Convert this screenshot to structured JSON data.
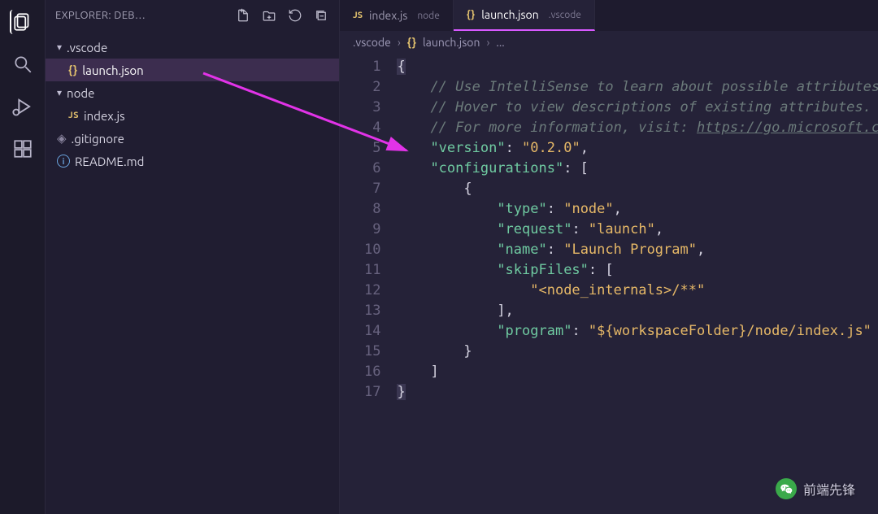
{
  "sidebar": {
    "title": "EXPLORER: DEB…",
    "actions": {
      "new_file": "new-file",
      "new_folder": "new-folder",
      "refresh": "refresh",
      "collapse": "collapse-all"
    },
    "tree": {
      "vscode_folder": ".vscode",
      "launch_json": "launch.json",
      "node_folder": "node",
      "index_js": "index.js",
      "gitignore": ".gitignore",
      "readme": "README.md"
    }
  },
  "tabs": {
    "index": {
      "name": "index.js",
      "desc": "node"
    },
    "launch": {
      "name": "launch.json",
      "desc": ".vscode"
    }
  },
  "breadcrumb": {
    "seg1": ".vscode",
    "seg2": "launch.json",
    "seg3": "..."
  },
  "code": {
    "l1": "{",
    "l2c": "// Use IntelliSense to learn about possible attributes",
    "l3c": "// Hover to view descriptions of existing attributes.",
    "l4c_a": "// For more information, visit: ",
    "l4c_b": "https://go.microsoft.c",
    "l5_k": "\"version\"",
    "l5_v": "\"0.2.0\"",
    "l6_k": "\"configurations\"",
    "l7": "{",
    "l8_k": "\"type\"",
    "l8_v": "\"node\"",
    "l9_k": "\"request\"",
    "l9_v": "\"launch\"",
    "l10_k": "\"name\"",
    "l10_v": "\"Launch Program\"",
    "l11_k": "\"skipFiles\"",
    "l12_v": "\"<node_internals>/**\"",
    "l13": "],",
    "l14_k": "\"program\"",
    "l14_v": "\"${workspaceFolder}/node/index.js\"",
    "l15": "}",
    "l16": "]",
    "l17": "}"
  },
  "watermark": "前端先锋"
}
